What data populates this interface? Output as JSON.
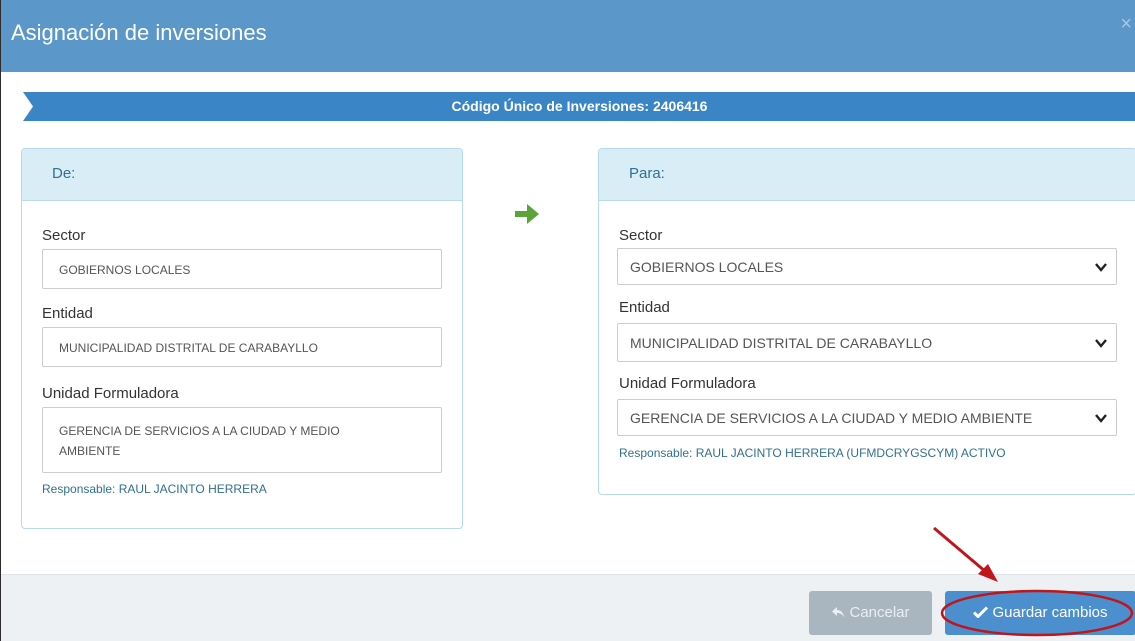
{
  "modal": {
    "title": "Asignación de inversiones",
    "close_icon": "×"
  },
  "banner": {
    "text": "Código Único de Inversiones: 2406416"
  },
  "from_panel": {
    "heading": "De:",
    "sector_label": "Sector",
    "sector_value": "GOBIERNOS LOCALES",
    "entidad_label": "Entidad",
    "entidad_value": "MUNICIPALIDAD DISTRITAL DE CARABAYLLO",
    "unidad_label": "Unidad Formuladora",
    "unidad_value_line1": "GERENCIA DE SERVICIOS A LA CIUDAD Y MEDIO",
    "unidad_value_line2": "AMBIENTE",
    "responsable": "Responsable: RAUL JACINTO HERRERA"
  },
  "to_panel": {
    "heading": "Para:",
    "sector_label": "Sector",
    "sector_value": "GOBIERNOS LOCALES",
    "entidad_label": "Entidad",
    "entidad_value": "MUNICIPALIDAD DISTRITAL DE CARABAYLLO",
    "unidad_label": "Unidad Formuladora",
    "unidad_value": "GERENCIA DE SERVICIOS A LA CIUDAD Y MEDIO AMBIENTE",
    "responsable": "Responsable: RAUL JACINTO HERRERA (UFMDCRYGSCYM) ACTIVO"
  },
  "footer": {
    "cancel_label": "Cancelar",
    "save_label": "Guardar cambios"
  },
  "icons": {
    "transfer_arrow": "arrow-right-icon",
    "chevron": "chevron-down-icon",
    "cancel": "reply-icon",
    "save": "check-icon"
  },
  "colors": {
    "header": "#5b97c9",
    "banner": "#3a85c6",
    "panel_heading": "#d9edf7",
    "arrow_green": "#5aa43a",
    "save_button": "#4b8fcf",
    "annotation_red": "#c0161b"
  }
}
